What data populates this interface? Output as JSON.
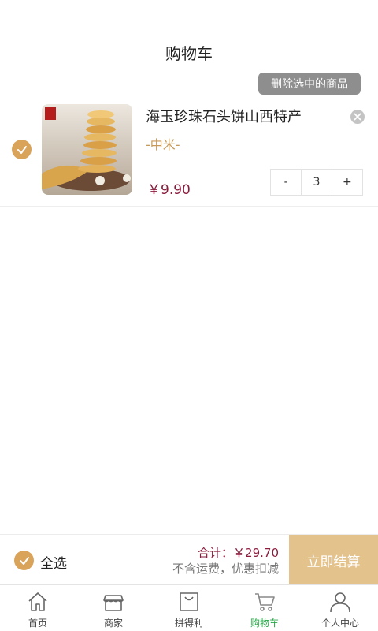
{
  "header": {
    "title": "购物车"
  },
  "actions": {
    "delete_selected": "删除选中的商品"
  },
  "cart": {
    "items": [
      {
        "name": "海玉珍珠石头饼山西特产",
        "spec": "-中米-",
        "price": "￥9.90",
        "quantity": "3",
        "selected": true
      }
    ]
  },
  "stepper": {
    "minus": "-",
    "plus": "+"
  },
  "summary": {
    "select_all": "全选",
    "total": "合计：￥29.70",
    "note": "不含运费，优惠扣减",
    "checkout": "立即结算"
  },
  "tabbar": {
    "items": [
      {
        "label": "首页",
        "icon": "home-icon"
      },
      {
        "label": "商家",
        "icon": "store-icon"
      },
      {
        "label": "拼得利",
        "icon": "shopping-bag-icon"
      },
      {
        "label": "购物车",
        "icon": "cart-icon",
        "active": true
      },
      {
        "label": "个人中心",
        "icon": "user-icon"
      }
    ]
  },
  "colors": {
    "accent": "#d9a35a",
    "checkout": "#e3c28c",
    "price": "#8a1c3c",
    "active_tab": "#2aa84a"
  }
}
